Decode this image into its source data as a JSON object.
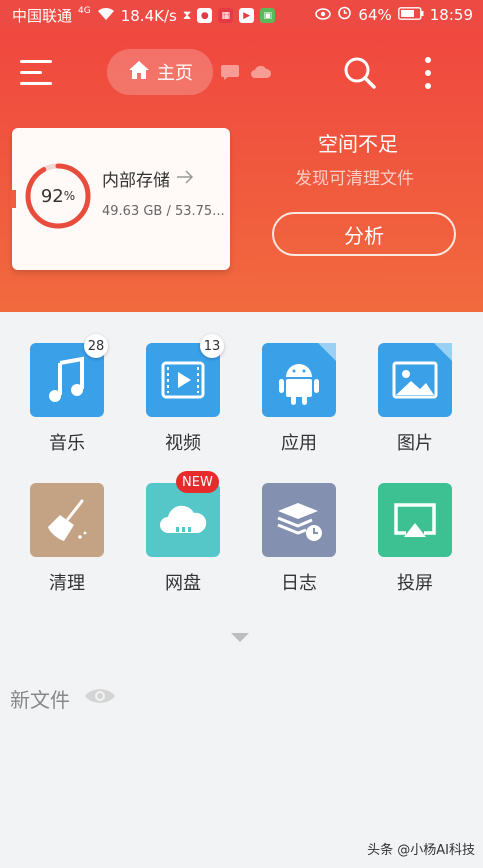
{
  "status_bar": {
    "carrier": "中国联通",
    "network": "4G",
    "speed": "18.4K/s",
    "battery": "64%",
    "time": "18:59"
  },
  "toolbar": {
    "home_label": "主页"
  },
  "storage": {
    "percent_text": "92",
    "percent_sign": "%",
    "percent_value": 92,
    "title": "内部存储",
    "size": "49.63 GB / 53.75..."
  },
  "space_alert": {
    "title": "空间不足",
    "subtitle": "发现可清理文件",
    "button": "分析"
  },
  "categories": [
    {
      "label": "音乐",
      "icon": "music-icon",
      "badge": "28",
      "color": "#3aa0e8"
    },
    {
      "label": "视频",
      "icon": "video-icon",
      "badge": "13",
      "color": "#3aa0e8"
    },
    {
      "label": "应用",
      "icon": "android-icon",
      "color": "#3aa0e8"
    },
    {
      "label": "图片",
      "icon": "image-icon",
      "color": "#3aa0e8"
    },
    {
      "label": "清理",
      "icon": "broom-icon",
      "color": "#c4a385"
    },
    {
      "label": "网盘",
      "icon": "cloud-icon",
      "badge_new": "NEW",
      "color": "#56c7c9"
    },
    {
      "label": "日志",
      "icon": "log-icon",
      "color": "#8390b0"
    },
    {
      "label": "投屏",
      "icon": "cast-icon",
      "color": "#3dc193"
    }
  ],
  "recent": {
    "title": "新文件"
  },
  "watermark": "头条 @小杨AI科技",
  "colors": {
    "header_top": "#f0473f",
    "header_bottom": "#f16a3e",
    "ring": "#e74c3c"
  }
}
